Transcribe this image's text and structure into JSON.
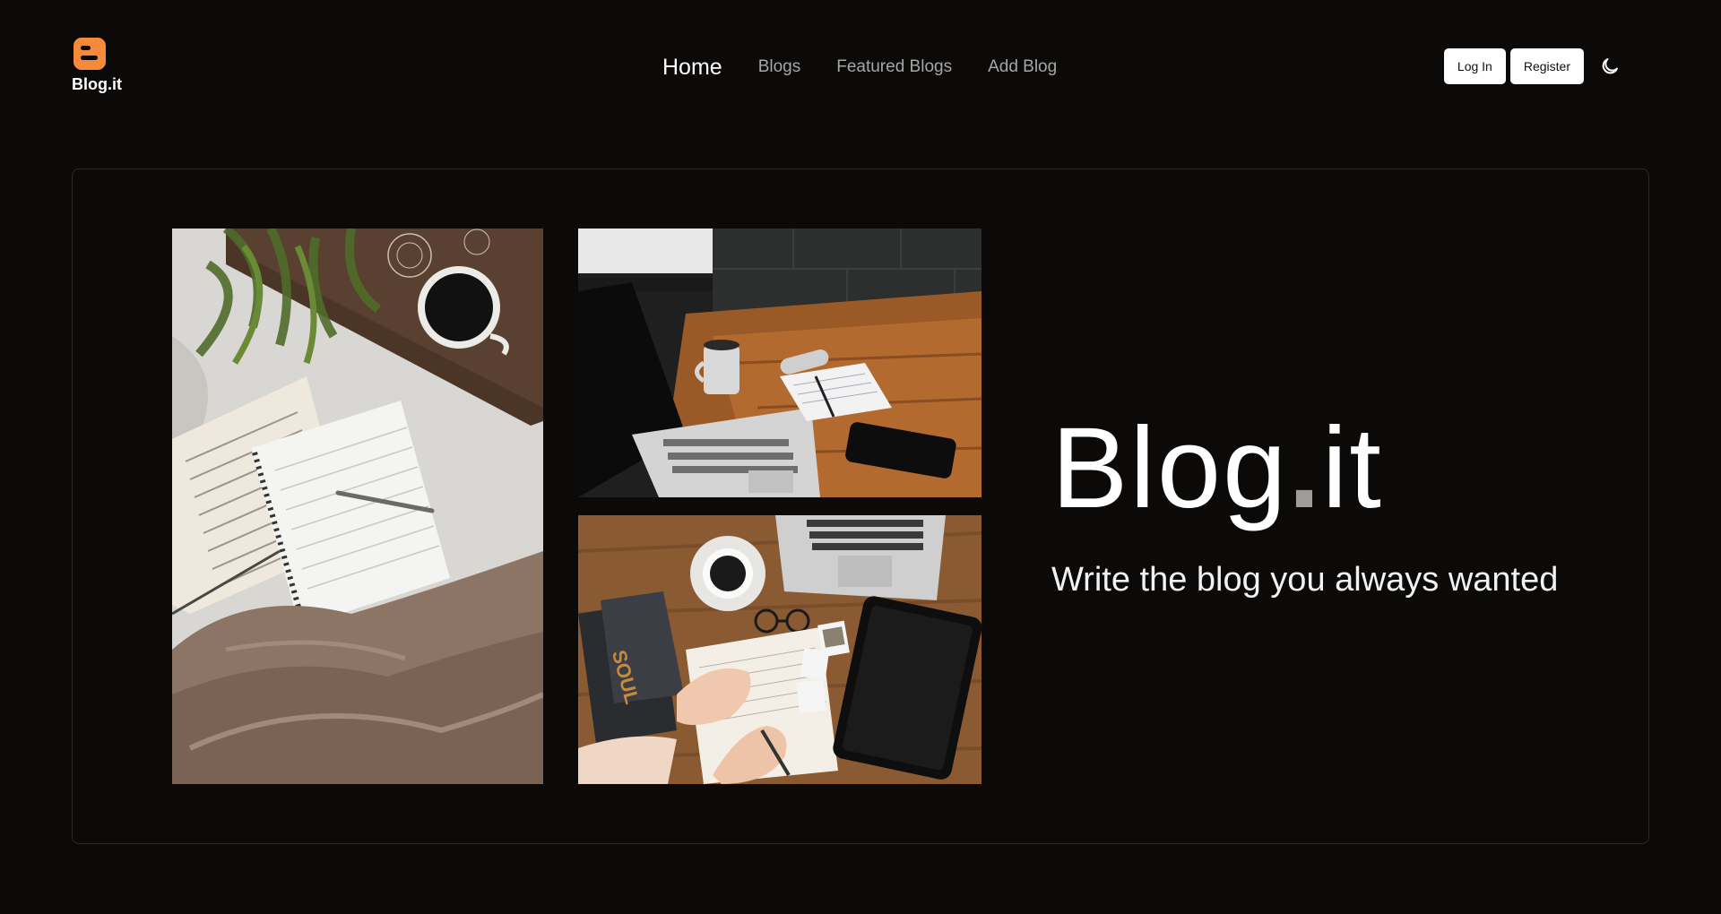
{
  "brand": {
    "name": "Blog.it",
    "accent": "#f7893a"
  },
  "nav": {
    "items": [
      {
        "label": "Home",
        "active": true
      },
      {
        "label": "Blogs",
        "active": false
      },
      {
        "label": "Featured Blogs",
        "active": false
      },
      {
        "label": "Add Blog",
        "active": false
      }
    ]
  },
  "actions": {
    "login_label": "Log In",
    "register_label": "Register",
    "theme_icon": "moon-icon"
  },
  "hero": {
    "title_part1": "Blog",
    "title_dot": ".",
    "title_part2": "it",
    "subtitle": "Write the blog you always wanted",
    "images": [
      {
        "name": "notebook-on-bed-photo"
      },
      {
        "name": "laptop-desk-coffee-photo"
      },
      {
        "name": "writing-journal-desk-photo"
      }
    ]
  },
  "colors": {
    "background": "#0b0a09",
    "border": "#2b2926",
    "nav_inactive": "#a6a6a6",
    "title_dot": "#a09d99"
  }
}
